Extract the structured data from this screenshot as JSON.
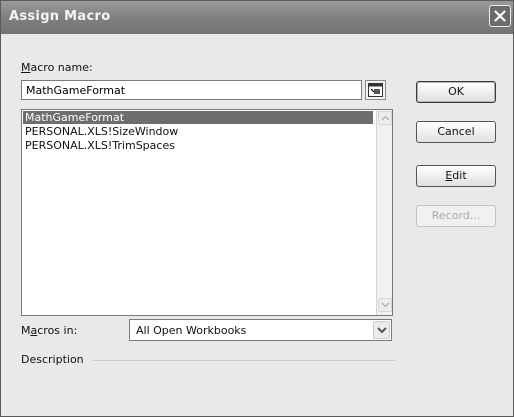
{
  "window": {
    "title": "Assign Macro"
  },
  "macro_name": {
    "label_prefix": "",
    "label_accel": "M",
    "label_rest": "acro name:",
    "value": "MathGameFormat"
  },
  "macro_list": {
    "items": [
      "MathGameFormat",
      "PERSONAL.XLS!SizeWindow",
      "PERSONAL.XLS!TrimSpaces"
    ],
    "selected_index": 0
  },
  "buttons": {
    "ok": "OK",
    "cancel": "Cancel",
    "edit_accel": "E",
    "edit_rest": "dit",
    "record": "Record..."
  },
  "macros_in": {
    "label_prefix": "M",
    "label_accel": "a",
    "label_rest": "cros in:",
    "value": "All Open Workbooks"
  },
  "description": {
    "label": "Description"
  },
  "colors": {
    "titlebar": "#7e7e7e",
    "selection": "#6e6e6e",
    "dialog_bg": "#e9e9e9"
  },
  "icons": {
    "close": "close-icon",
    "collapse": "collapse-dialog-icon",
    "dropdown": "chevron-down-icon"
  }
}
